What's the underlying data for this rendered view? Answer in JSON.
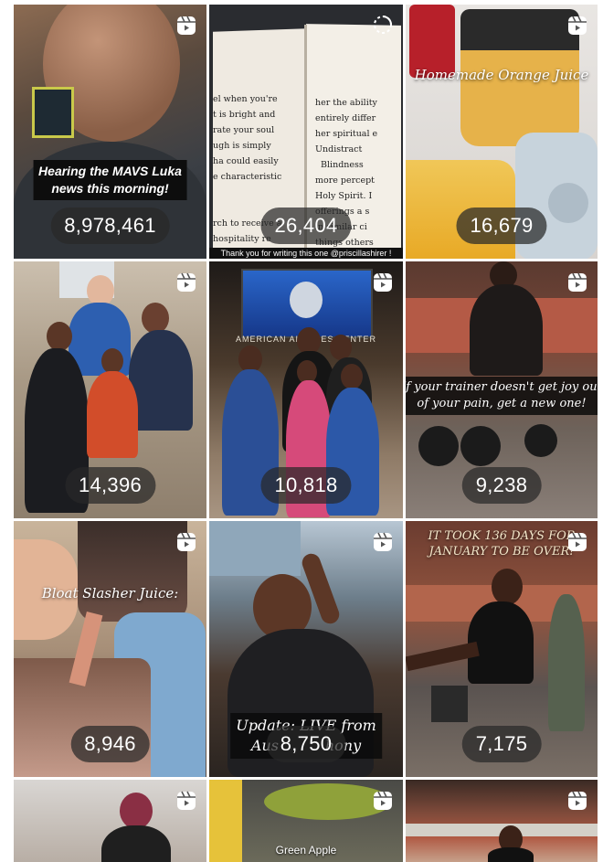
{
  "tiles": [
    {
      "name": "reel-mavs-luka",
      "views": "8,978,461",
      "caption": "Hearing the MAVS Luka\nnews this morning!",
      "icon": "reel-icon"
    },
    {
      "name": "reel-book",
      "views": "26,404",
      "caption": "Thank you for writing this one @priscillashirer !",
      "icon": "loading-spinner-icon",
      "book_left": "el when you're\nt is bright and\nrate your soul\nugh is simply\nha could easily\ne characteristic\n\n\nrch to receive a\nhospitality re\nhe center of",
      "book_right": "her the ability\nentirely differ\nher spiritual e\nUndistract\n  Blindness\nmore percept\nHoly Spirit. I\nofferings a s\nin similar ci\nthings others\nMichelle said\nof God, could"
    },
    {
      "name": "reel-orange-juice",
      "views": "16,679",
      "caption": "Homemade Orange Juice",
      "icon": "reel-icon"
    },
    {
      "name": "reel-gym-family",
      "views": "14,396",
      "caption": "",
      "icon": "reel-icon"
    },
    {
      "name": "reel-arena",
      "views": "10,818",
      "caption": "",
      "icon": "reel-icon",
      "signage": "AMERICAN AIRLINES CENTER"
    },
    {
      "name": "reel-trainer",
      "views": "9,238",
      "caption": "If your trainer doesn't get joy out\nof your pain, get a new one!",
      "icon": "reel-icon"
    },
    {
      "name": "reel-bloat-juice",
      "views": "8,946",
      "caption": "Bloat Slasher Juice:",
      "icon": "reel-icon"
    },
    {
      "name": "reel-update-live",
      "views": "8,750",
      "caption": "Update: LIVE from\nAus          hony",
      "icon": "reel-icon"
    },
    {
      "name": "reel-136-days",
      "views": "7,175",
      "caption": "IT TOOK 136 DAYS FOR\nJANUARY TO BE OVER!",
      "icon": "reel-icon"
    },
    {
      "name": "reel-gym-selfie",
      "views": "",
      "caption": "",
      "icon": "reel-icon"
    },
    {
      "name": "reel-green-apple",
      "views": "",
      "caption": "Green Apple",
      "icon": "reel-icon"
    },
    {
      "name": "reel-gym-woman",
      "views": "",
      "caption": "",
      "icon": "reel-icon"
    }
  ]
}
